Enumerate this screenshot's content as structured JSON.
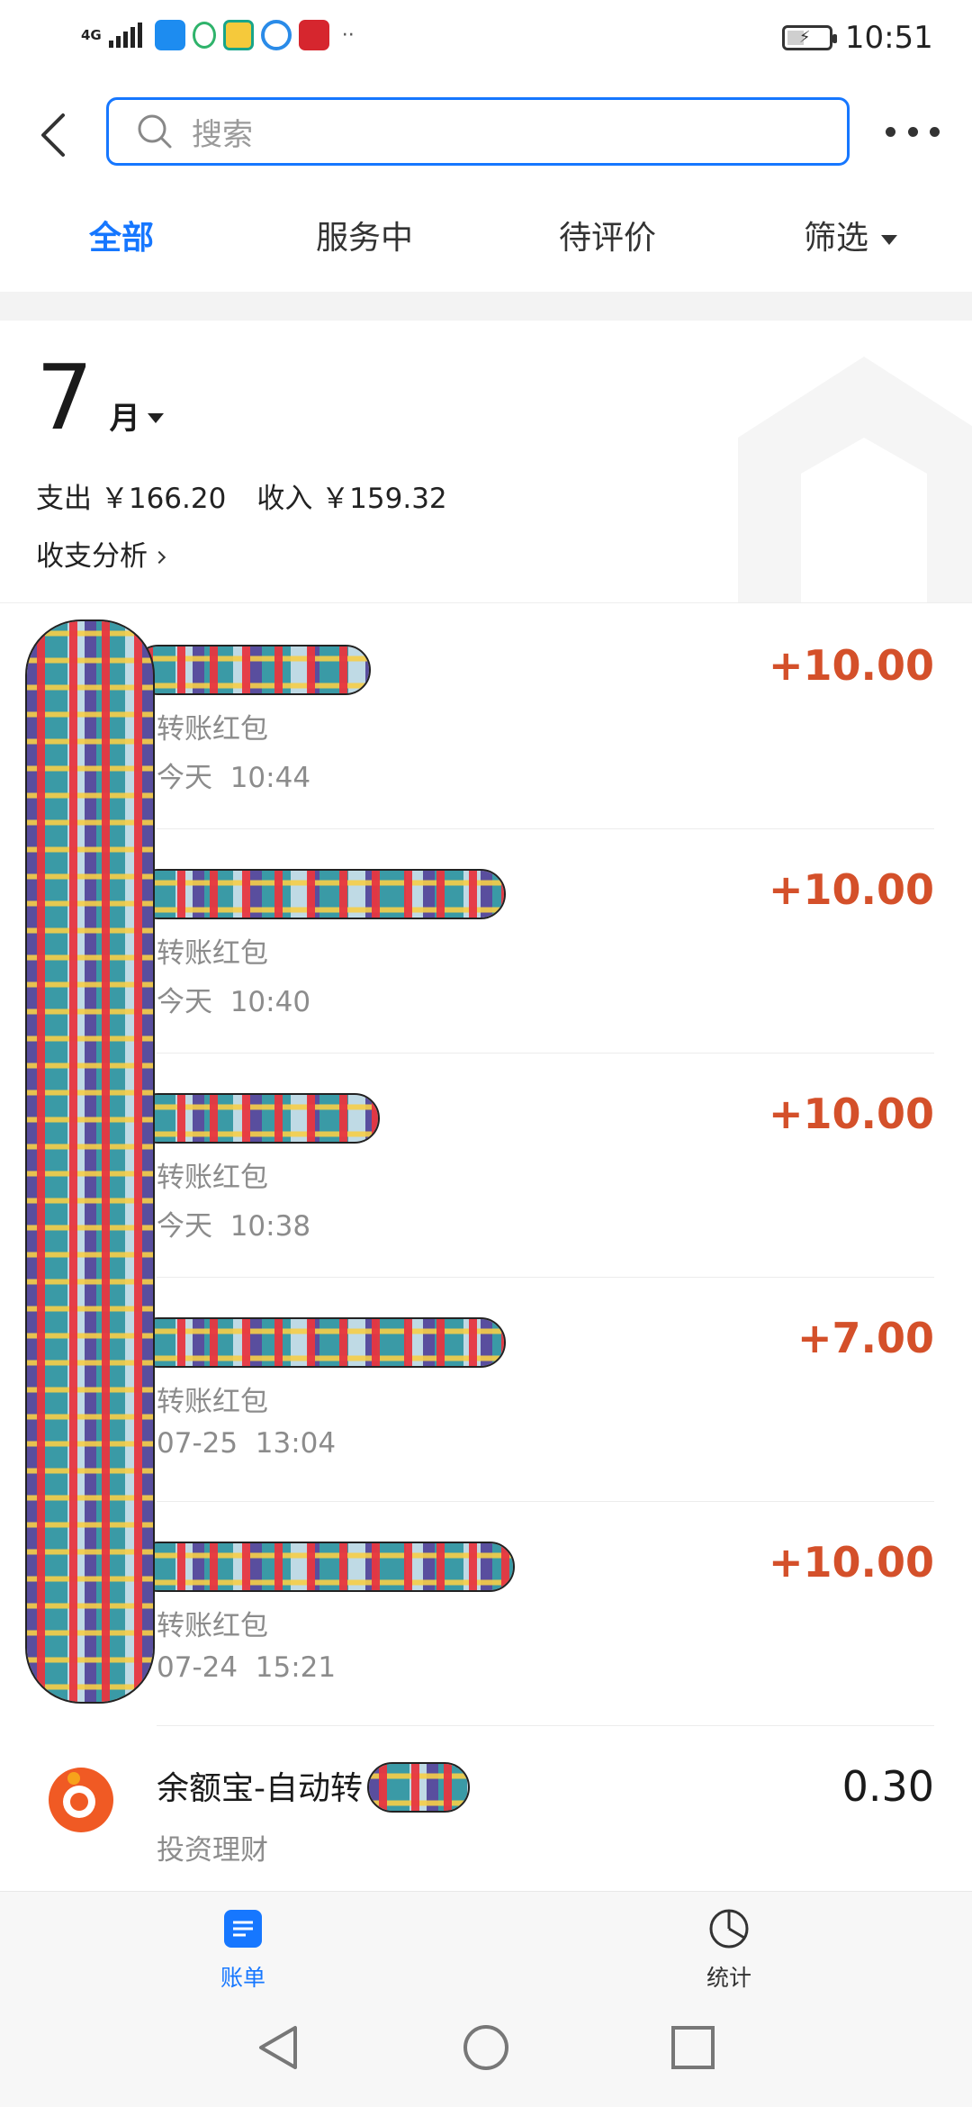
{
  "status_bar": {
    "network": "4G",
    "time": "10:51"
  },
  "search": {
    "placeholder": "搜索"
  },
  "tabs": [
    {
      "label": "全部"
    },
    {
      "label": "服务中"
    },
    {
      "label": "待评价"
    },
    {
      "label": "筛选"
    }
  ],
  "summary": {
    "month": "7",
    "month_unit": "月",
    "expense": "支出 ￥166.20",
    "income": "收入 ￥159.32",
    "analysis": "收支分析"
  },
  "transactions": [
    {
      "category": "转账红包",
      "time": "今天  10:44",
      "amount": "+10.00"
    },
    {
      "category": "转账红包",
      "time": "今天  10:40",
      "amount": "+10.00"
    },
    {
      "category": "转账红包",
      "time": "今天  10:38",
      "amount": "+10.00"
    },
    {
      "category": "转账红包",
      "time": "07-25  13:04",
      "amount": "+7.00"
    },
    {
      "category": "转账红包",
      "time": "07-24  15:21",
      "amount": "+10.00"
    },
    {
      "title": "余额宝-自动转",
      "category": "投资理财",
      "amount": "0.30"
    }
  ],
  "bottom_nav": [
    {
      "label": "账单"
    },
    {
      "label": "统计"
    }
  ],
  "colors": {
    "accent": "#1677ff",
    "income": "#d4502a"
  }
}
